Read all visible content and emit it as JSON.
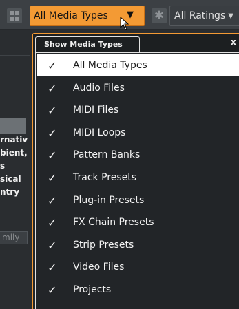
{
  "toolbar": {
    "media_types_label": "All Media Types",
    "media_types_caret": "▼",
    "ratings_label": "All Ratings",
    "ratings_caret": "▼",
    "star_glyph": "✱"
  },
  "background_list": {
    "items": [
      "rnativ",
      "bient,",
      "s",
      "sical",
      "ntry"
    ],
    "field_text": "mily"
  },
  "popup": {
    "title": "Show Media Types",
    "close_label": "x",
    "check_glyph": "✓",
    "items": [
      {
        "label": "All Media Types",
        "checked": true,
        "selected": true
      },
      {
        "label": "Audio Files",
        "checked": true,
        "selected": false
      },
      {
        "label": "MIDI Files",
        "checked": true,
        "selected": false
      },
      {
        "label": "MIDI Loops",
        "checked": true,
        "selected": false
      },
      {
        "label": "Pattern Banks",
        "checked": true,
        "selected": false
      },
      {
        "label": "Track Presets",
        "checked": true,
        "selected": false
      },
      {
        "label": "Plug-in Presets",
        "checked": true,
        "selected": false
      },
      {
        "label": "FX Chain Presets",
        "checked": true,
        "selected": false
      },
      {
        "label": "Strip Presets",
        "checked": true,
        "selected": false
      },
      {
        "label": "Video Files",
        "checked": true,
        "selected": false
      },
      {
        "label": "Projects",
        "checked": true,
        "selected": false
      }
    ]
  },
  "colors": {
    "accent": "#f39a34",
    "popup_bg": "#222528",
    "selected_bg": "#ffffff"
  }
}
